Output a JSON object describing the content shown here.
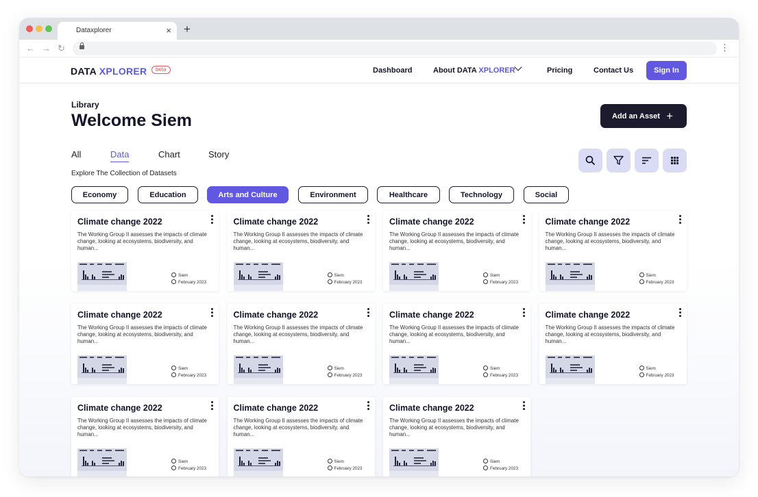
{
  "browser": {
    "tab_title": "Dataxplorer",
    "tab_close": "×",
    "new_tab": "+",
    "back": "←",
    "forward": "→",
    "reload": "↻",
    "menu": "⋮",
    "dot_colors": [
      "#ed5e58",
      "#f6be4f",
      "#61c554"
    ]
  },
  "header": {
    "logo_main": "DATA ",
    "logo_accent": "XPLORER",
    "logo_badge": "beta",
    "nav": {
      "dashboard": "Dashboard",
      "about_prefix": "About DATA ",
      "about_accent": "XPLORER",
      "pricing": "Pricing",
      "contact": "Contact Us"
    },
    "sign_in": "Sign In"
  },
  "main": {
    "library_label": "Library",
    "welcome": "Welcome Siem",
    "add_asset_label": "Add an Asset",
    "add_asset_icon": "+",
    "tabs": [
      "All",
      "Data",
      "Chart",
      "Story"
    ],
    "active_tab": "Data",
    "explore_text": "Explore The Collection of Datasets",
    "tool_icons": [
      "search-icon",
      "filter-icon",
      "sort-icon",
      "grid-view-icon"
    ],
    "categories": [
      "Economy",
      "Education",
      "Arts and Culture",
      "Environment",
      "Healthcare",
      "Technology",
      "Social"
    ],
    "active_category": "Arts and Culture"
  },
  "cards": [
    {
      "title": "Climate change 2022",
      "description": "The Working Group II assesses the impacts of climate change, looking at ecosystems, biodiversity, and human...",
      "author": "Siem",
      "date": "February 2023"
    },
    {
      "title": "Climate change 2022",
      "description": "The Working Group II assesses the impacts of climate change, looking at ecosystems, biodiversity, and human...",
      "author": "Siem",
      "date": "February 2023"
    },
    {
      "title": "Climate change 2022",
      "description": "The Working Group II assesses the impacts of climate change, looking at ecosystems, biodiversity, and human...",
      "author": "Siem",
      "date": "February 2023"
    },
    {
      "title": "Climate change 2022",
      "description": "The Working Group II assesses the impacts of climate change, looking at ecosystems, biodiversity, and human...",
      "author": "Siem",
      "date": "February 2023"
    },
    {
      "title": "Climate change 2022",
      "description": "The Working Group II assesses the impacts of climate change, looking at ecosystems, biodiversity, and human...",
      "author": "Siem",
      "date": "February 2023"
    },
    {
      "title": "Climate change 2022",
      "description": "The Working Group II assesses the impacts of climate change, looking at ecosystems, biodiversity, and human...",
      "author": "Siem",
      "date": "February 2023"
    },
    {
      "title": "Climate change 2022",
      "description": "The Working Group II assesses the impacts of climate change, looking at ecosystems, biodiversity, and human...",
      "author": "Siem",
      "date": "February 2023"
    },
    {
      "title": "Climate change 2022",
      "description": "The Working Group II assesses the impacts of climate change, looking at ecosystems, biodiversity, and human...",
      "author": "Siem",
      "date": "February 2023"
    },
    {
      "title": "Climate change 2022",
      "description": "The Working Group II assesses the impacts of climate change, looking at ecosystems, biodiversity, and human...",
      "author": "Siem",
      "date": "February 2023"
    },
    {
      "title": "Climate change 2022",
      "description": "The Working Group II assesses the impacts of climate change, looking at ecosystems, biodiversity, and human...",
      "author": "Siem",
      "date": "February 2023"
    },
    {
      "title": "Climate change 2022",
      "description": "The Working Group II assesses the impacts of climate change, looking at ecosystems, biodiversity, and human...",
      "author": "Siem",
      "date": "February 2023"
    }
  ],
  "colors": {
    "accent": "#6157e0",
    "accent_text": "#5b5bd6",
    "dark": "#1c1b2e",
    "tool_bg": "#dadcf6",
    "badge": "#e05a5a"
  }
}
